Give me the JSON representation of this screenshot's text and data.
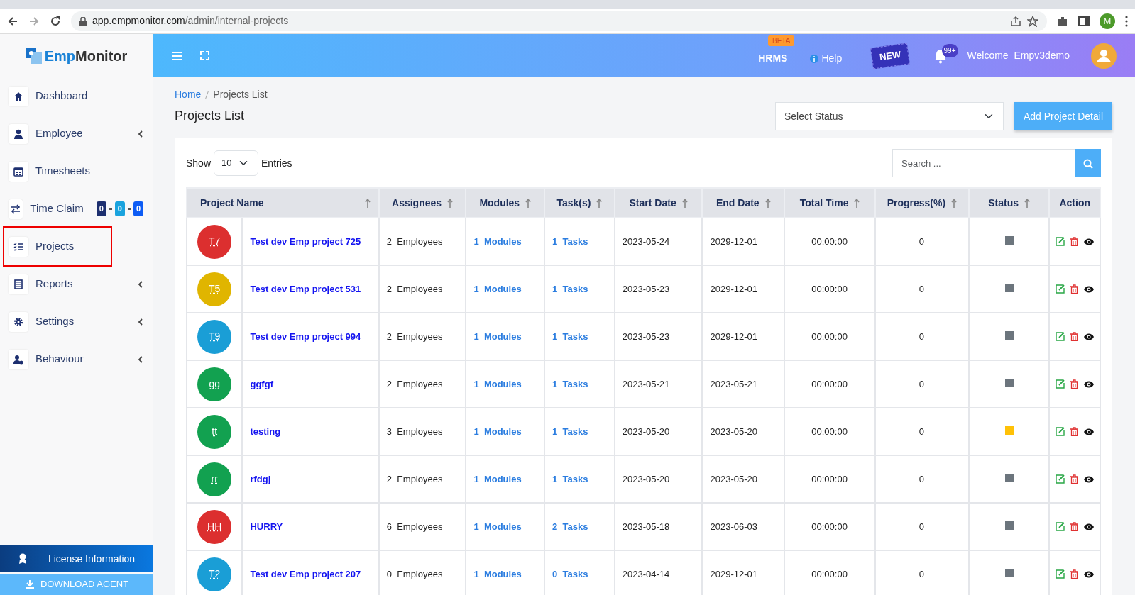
{
  "browser": {
    "url_host": "app.empmonitor.com",
    "url_path": "/admin/internal-projects",
    "profile_initial": "M"
  },
  "sidebar": {
    "logo": {
      "first": "Emp",
      "second": "Monitor"
    },
    "items": [
      {
        "label": "Dashboard",
        "selected": false,
        "expandable": false
      },
      {
        "label": "Employee",
        "selected": false,
        "expandable": true
      },
      {
        "label": "Timesheets",
        "selected": false,
        "expandable": false
      },
      {
        "label": "Time Claim",
        "selected": false,
        "expandable": false,
        "badges": [
          {
            "text": "0",
            "color": "#1d2f6f"
          },
          {
            "text": "0",
            "color": "#1aa3de"
          },
          {
            "text": "0",
            "color": "#0d5cf5"
          }
        ]
      },
      {
        "label": "Projects",
        "selected": true,
        "expandable": false
      },
      {
        "label": "Reports",
        "selected": false,
        "expandable": true
      },
      {
        "label": "Settings",
        "selected": false,
        "expandable": true
      },
      {
        "label": "Behaviour",
        "selected": false,
        "expandable": true
      }
    ],
    "license": "License Information",
    "download": "DOWNLOAD AGENT"
  },
  "topbar": {
    "hrms": "HRMS",
    "beta": "BETA",
    "help": "Help",
    "new_label": "NEW",
    "notification_count": "99+",
    "welcome": "Welcome",
    "user": "Empv3demo"
  },
  "breadcrumb": [
    {
      "label": "Home",
      "kind": "link"
    },
    {
      "label": "Projects List",
      "kind": "current"
    }
  ],
  "title": "Projects List",
  "status_select": {
    "value": "Select Status"
  },
  "add_button": "Add Project Detail",
  "table_controls": {
    "show": "Show",
    "entries_value": "10",
    "entries": "Entries",
    "search_placeholder": "Search ..."
  },
  "table": {
    "columns": [
      {
        "label": "Project Name",
        "sortable": true
      },
      {
        "label": "Assignees",
        "sortable": true
      },
      {
        "label": "Modules",
        "sortable": true
      },
      {
        "label": "Task(s)",
        "sortable": true
      },
      {
        "label": "Start Date",
        "sortable": true
      },
      {
        "label": "End Date",
        "sortable": true
      },
      {
        "label": "Total Time",
        "sortable": true
      },
      {
        "label": "Progress(%)",
        "sortable": true
      },
      {
        "label": "Status",
        "sortable": true
      },
      {
        "label": "Action",
        "sortable": false
      }
    ],
    "rows": [
      {
        "avatar": {
          "initials": "T7",
          "color": "#dc2f2f"
        },
        "name": "Test dev Emp project 725",
        "assignees": "2  Employees",
        "modules": "1  Modules",
        "tasks": "1  Tasks",
        "start": "2023-05-24",
        "end": "2029-12-01",
        "total_time": "00:00:00",
        "progress": "0",
        "status": {
          "color": "#6c757d"
        }
      },
      {
        "avatar": {
          "initials": "T5",
          "color": "#e0b500"
        },
        "name": "Test dev Emp project 531",
        "assignees": "2  Employees",
        "modules": "1  Modules",
        "tasks": "1  Tasks",
        "start": "2023-05-23",
        "end": "2029-12-01",
        "total_time": "00:00:00",
        "progress": "0",
        "status": {
          "color": "#6c757d"
        }
      },
      {
        "avatar": {
          "initials": "T9",
          "color": "#1a9ed6"
        },
        "name": "Test dev Emp project 994",
        "assignees": "2  Employees",
        "modules": "1  Modules",
        "tasks": "1  Tasks",
        "start": "2023-05-23",
        "end": "2029-12-01",
        "total_time": "00:00:00",
        "progress": "0",
        "status": {
          "color": "#6c757d"
        }
      },
      {
        "avatar": {
          "initials": "gg",
          "color": "#12a150"
        },
        "name": "ggfgf",
        "assignees": "2  Employees",
        "modules": "1  Modules",
        "tasks": "1  Tasks",
        "start": "2023-05-21",
        "end": "2023-05-21",
        "total_time": "00:00:00",
        "progress": "0",
        "status": {
          "color": "#6c757d"
        }
      },
      {
        "avatar": {
          "initials": "tt",
          "color": "#12a150"
        },
        "name": "testing",
        "assignees": "3  Employees",
        "modules": "1  Modules",
        "tasks": "1  Tasks",
        "start": "2023-05-20",
        "end": "2023-05-20",
        "total_time": "00:00:00",
        "progress": "0",
        "status": {
          "color": "#ffc107"
        }
      },
      {
        "avatar": {
          "initials": "rr",
          "color": "#12a150"
        },
        "name": "rfdgj",
        "assignees": "2  Employees",
        "modules": "1  Modules",
        "tasks": "1  Tasks",
        "start": "2023-05-20",
        "end": "2023-05-20",
        "total_time": "00:00:00",
        "progress": "0",
        "status": {
          "color": "#6c757d"
        }
      },
      {
        "avatar": {
          "initials": "HH",
          "color": "#dc2f2f"
        },
        "name": "HURRY",
        "assignees": "6  Employees",
        "modules": "1  Modules",
        "tasks": "2  Tasks",
        "start": "2023-05-18",
        "end": "2023-06-03",
        "total_time": "00:00:00",
        "progress": "0",
        "status": {
          "color": "#6c757d"
        }
      },
      {
        "avatar": {
          "initials": "T2",
          "color": "#1a9ed6"
        },
        "name": "Test dev Emp project 207",
        "assignees": "0  Employees",
        "modules": "1  Modules",
        "tasks": "0  Tasks",
        "start": "2023-04-14",
        "end": "2029-12-01",
        "total_time": "00:00:00",
        "progress": "0",
        "status": {
          "color": "#6c757d"
        }
      }
    ]
  }
}
